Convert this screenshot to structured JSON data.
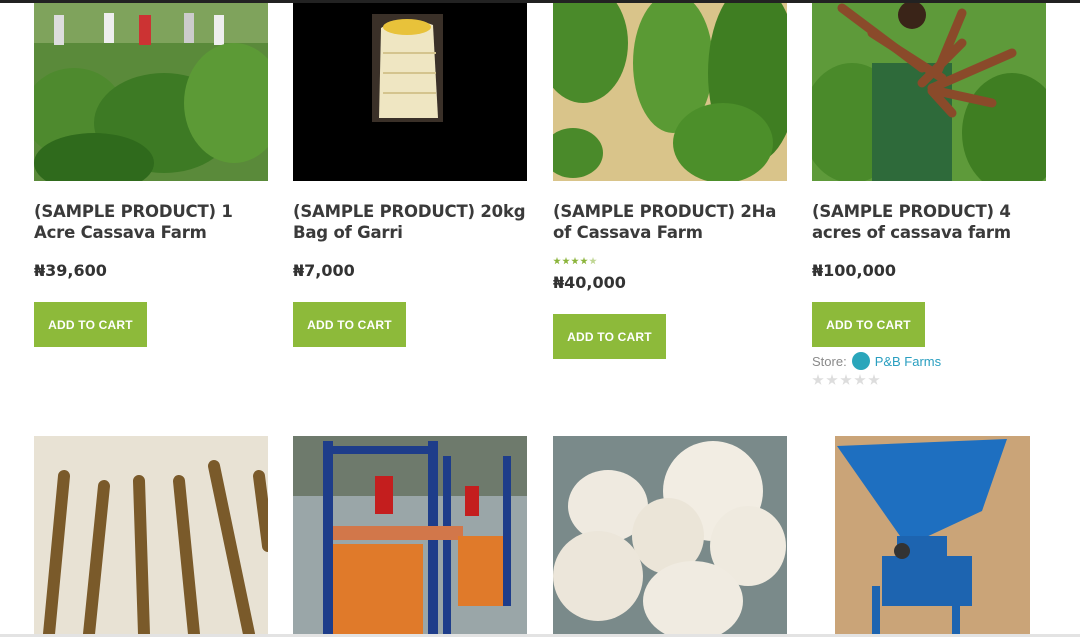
{
  "products": [
    {
      "title": "(SAMPLE PRODUCT) 1 Acre Cassava Farm",
      "price": "₦39,600",
      "button": "ADD TO CART"
    },
    {
      "title": "(SAMPLE PRODUCT) 20kg Bag of Garri",
      "price": "₦7,000",
      "button": "ADD TO CART"
    },
    {
      "title": "(SAMPLE PRODUCT) 2Ha of Cassava Farm",
      "price": "₦40,000",
      "button": "ADD TO CART",
      "rating": 4.5
    },
    {
      "title": "(SAMPLE PRODUCT) 4 acres of cassava farm",
      "price": "₦100,000",
      "button": "ADD TO CART",
      "store_label": "Store:",
      "store_name": "P&B Farms",
      "rating": 0
    }
  ],
  "colors": {
    "button": "#8dba3a",
    "store_link": "#2a9fc0",
    "star": "#8bb43b"
  }
}
